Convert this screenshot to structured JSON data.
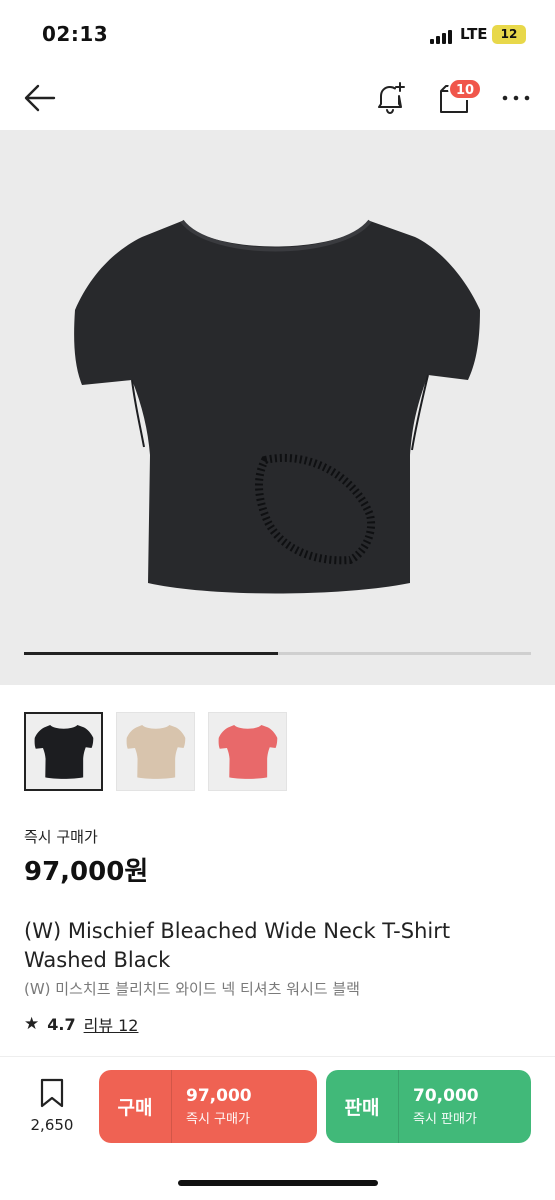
{
  "status_bar": {
    "time": "02:13",
    "network": "LTE",
    "battery": "12"
  },
  "nav": {
    "back_icon": "arrow-left-icon",
    "alert_icon": "bell-plus-icon",
    "box_icon": "shopping-box-icon",
    "box_badge": "10",
    "more_icon": "more-horizontal-icon"
  },
  "gallery": {
    "progress": 0.5,
    "thumbnails": [
      {
        "color": "#1c1d20",
        "selected": true
      },
      {
        "color": "#d8c4ad",
        "selected": false
      },
      {
        "color": "#e8696a",
        "selected": false
      }
    ]
  },
  "price": {
    "label": "즉시 구매가",
    "value": "97,000원"
  },
  "product": {
    "title_en": "(W) Mischief Bleached Wide Neck T-Shirt Washed Black",
    "title_ko": "(W) 미스치프 블리치드 와이드 넥 티셔츠 워시드 블랙",
    "rating": "4.7",
    "review_link": "리뷰 12"
  },
  "bottom_bar": {
    "wish_count": "2,650",
    "buy": {
      "label": "구매",
      "amount": "97,000",
      "sub": "즉시 구매가",
      "color": "#ef6253"
    },
    "sell": {
      "label": "판매",
      "amount": "70,000",
      "sub": "즉시 판매가",
      "color": "#41b979"
    }
  }
}
